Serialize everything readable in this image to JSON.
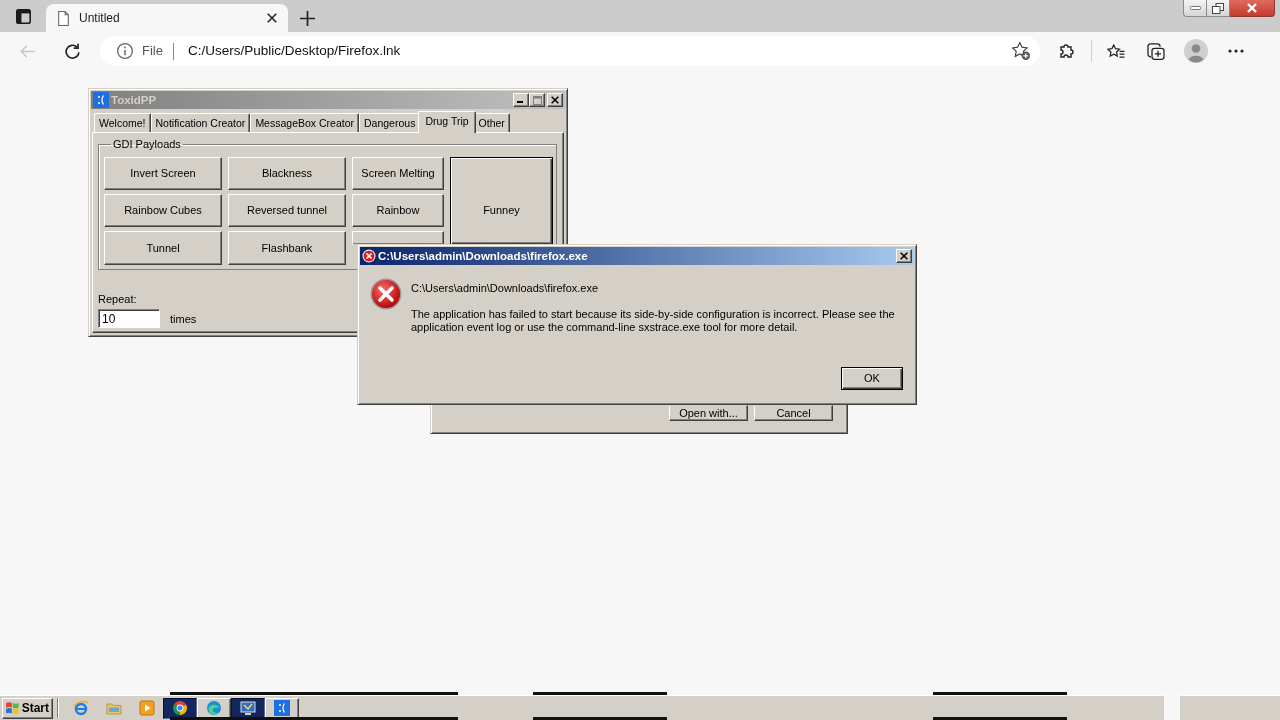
{
  "browser": {
    "tabs": [
      {
        "title": "Untitled",
        "selected": true
      }
    ],
    "navigation": {
      "back_disabled": true
    },
    "address_bar": {
      "security_label": "File",
      "url": "C:/Users/Public/Desktop/Firefox.lnk"
    }
  },
  "desktop": {
    "windows": [
      {
        "kind": "app",
        "title": "ToxidPP",
        "active": false,
        "maximize_disabled": true,
        "tabs": [
          {
            "label": "Welcome!",
            "selected": false
          },
          {
            "label": "Notification Creator",
            "selected": false
          },
          {
            "label": "MessageBox Creator",
            "selected": false
          },
          {
            "label": "Dangerous",
            "selected": false
          },
          {
            "label": "Drug Trip",
            "selected": true
          },
          {
            "label": "Other",
            "selected": false
          }
        ],
        "group": {
          "title": "GDI Payloads",
          "buttons": [
            {
              "kind": "normal",
              "label": "Invert Screen"
            },
            {
              "kind": "normal",
              "label": "Blackness"
            },
            {
              "kind": "normal",
              "label": "Screen Melting"
            },
            {
              "kind": "normal",
              "label": "Rainbow Cubes"
            },
            {
              "kind": "normal",
              "label": "Reversed tunnel"
            },
            {
              "kind": "normal",
              "label": "Rainbow"
            },
            {
              "kind": "tall",
              "label": "Funney"
            },
            {
              "kind": "normal",
              "label": "Tunnel"
            },
            {
              "kind": "normal",
              "label": "Flashbank"
            },
            {
              "kind": "normal"
            }
          ]
        },
        "repeat": {
          "label": "Repeat:",
          "value": "10",
          "unit": "times"
        }
      },
      {
        "kind": "dialog",
        "buttons": [
          {
            "label": "Open with..."
          },
          {
            "label": "Cancel"
          }
        ]
      },
      {
        "kind": "error",
        "title": "C:\\Users\\admin\\Downloads\\firefox.exe",
        "active": true,
        "heading": "C:\\Users\\admin\\Downloads\\firefox.exe",
        "message": "The application has failed to start because its side-by-side configuration is incorrect. Please see the application event log or use the command-line sxstrace.exe tool for more detail.",
        "buttons": [
          {
            "label": "OK",
            "default": true
          }
        ]
      }
    ]
  },
  "taskbar": {
    "start": "Start",
    "quick_launch": [
      {
        "kind": "elogo"
      },
      {
        "kind": "folder"
      },
      {
        "kind": "player"
      }
    ],
    "tasks": [
      {
        "kind": "circle",
        "highlighted": true
      },
      {
        "kind": "wave",
        "highlighted": false
      },
      {
        "kind": "monitor",
        "highlighted": true
      },
      {
        "kind": "sadface",
        "highlighted": false
      }
    ]
  }
}
